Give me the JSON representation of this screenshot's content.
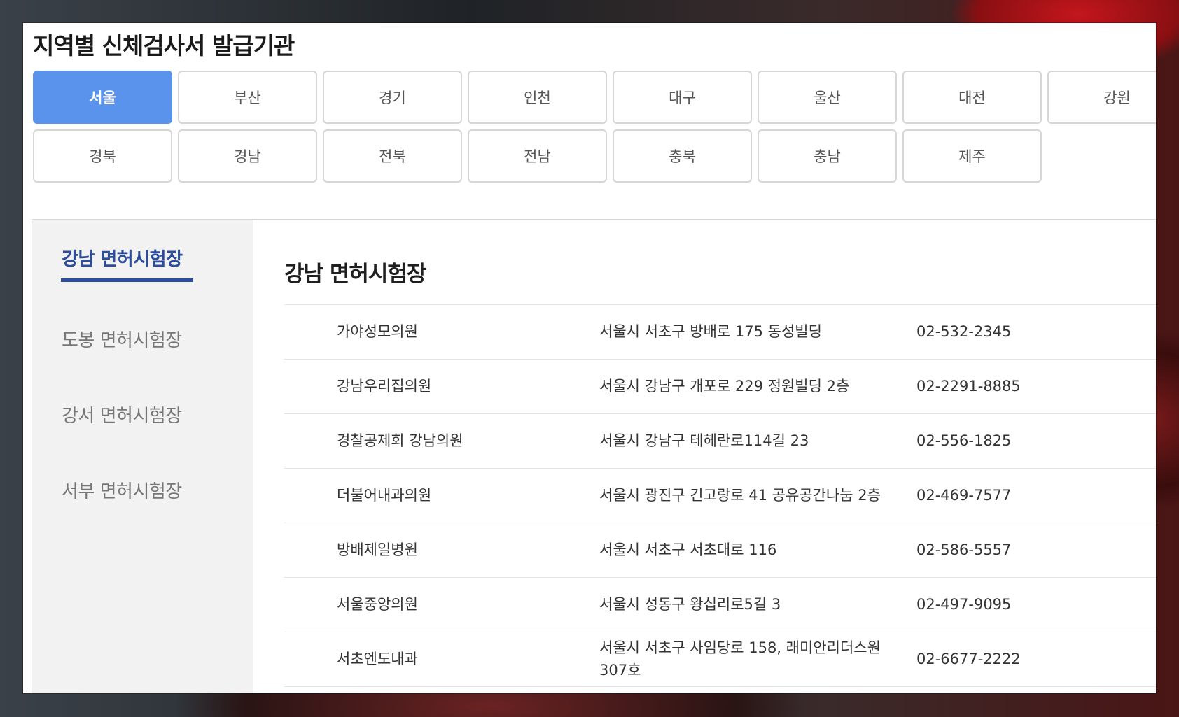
{
  "page": {
    "title": "지역별 신체검사서 발급기관"
  },
  "regions": [
    {
      "label": "서울",
      "active": true
    },
    {
      "label": "부산"
    },
    {
      "label": "경기"
    },
    {
      "label": "인천"
    },
    {
      "label": "대구"
    },
    {
      "label": "울산"
    },
    {
      "label": "대전"
    },
    {
      "label": "강원"
    },
    {
      "label": "경북"
    },
    {
      "label": "경남"
    },
    {
      "label": "전북"
    },
    {
      "label": "전남"
    },
    {
      "label": "충북"
    },
    {
      "label": "충남"
    },
    {
      "label": "제주"
    }
  ],
  "centers": [
    {
      "label": "강남 면허시험장",
      "active": true
    },
    {
      "label": "도봉 면허시험장"
    },
    {
      "label": "강서 면허시험장"
    },
    {
      "label": "서부 면허시험장"
    }
  ],
  "main": {
    "title": "강남 면허시험장",
    "rows": [
      {
        "name": "가야성모의원",
        "address": "서울시 서초구 방배로 175 동성빌딩",
        "tel": "02-532-2345"
      },
      {
        "name": "강남우리집의원",
        "address": "서울시 강남구 개포로 229 정원빌딩 2층",
        "tel": "02-2291-8885"
      },
      {
        "name": "경찰공제회 강남의원",
        "address": "서울시 강남구 테헤란로114길 23",
        "tel": "02-556-1825"
      },
      {
        "name": "더불어내과의원",
        "address": "서울시 광진구 긴고랑로 41 공유공간나눔 2층",
        "tel": "02-469-7577"
      },
      {
        "name": "방배제일병원",
        "address": "서울시 서초구 서초대로 116",
        "tel": "02-586-5557"
      },
      {
        "name": "서울중앙의원",
        "address": "서울시 성동구 왕십리로5길 3",
        "tel": "02-497-9095"
      },
      {
        "name": "서초엔도내과",
        "address": "서울시 서초구 사임당로 158, 래미안리더스원 307호",
        "tel": "02-6677-2222"
      }
    ]
  },
  "colors": {
    "accent": "#5a93ec",
    "sidebar_active": "#2c4c9c"
  }
}
